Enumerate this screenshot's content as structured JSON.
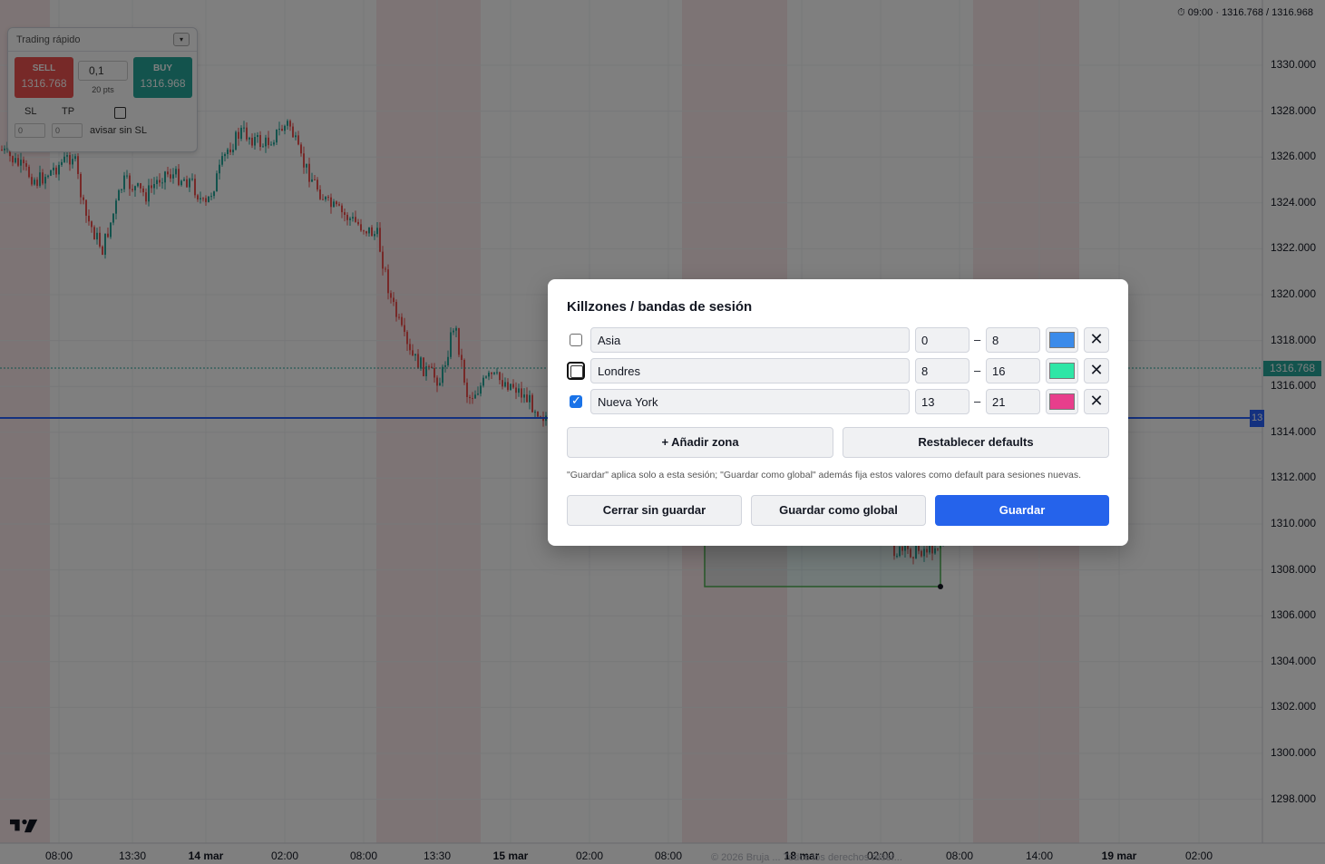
{
  "top_info": "⏱ 09:00 · 1316.768 / 1316.968",
  "price_axis": {
    "labels": [
      "1330.000",
      "1328.000",
      "1326.000",
      "1324.000",
      "1322.000",
      "1320.000",
      "1318.000",
      "1316.000",
      "1314.000",
      "1312.000",
      "1310.000",
      "1308.000",
      "1306.000",
      "1304.000",
      "1302.000",
      "1300.000",
      "1298.000"
    ],
    "current_price": "1316.768",
    "hline_tag": "13"
  },
  "time_axis": {
    "labels": [
      {
        "text": "08:00",
        "bold": false
      },
      {
        "text": "13:30",
        "bold": false
      },
      {
        "text": "14 mar",
        "bold": true
      },
      {
        "text": "02:00",
        "bold": false
      },
      {
        "text": "08:00",
        "bold": false
      },
      {
        "text": "13:30",
        "bold": false
      },
      {
        "text": "15 mar",
        "bold": true
      },
      {
        "text": "02:00",
        "bold": false
      },
      {
        "text": "08:00",
        "bold": false
      },
      {
        "text": "18 mar",
        "bold": true
      },
      {
        "text": "02:00",
        "bold": false
      },
      {
        "text": "08:00",
        "bold": false
      },
      {
        "text": "14:00",
        "bold": false
      },
      {
        "text": "19 mar",
        "bold": true
      },
      {
        "text": "02:00",
        "bold": false
      }
    ]
  },
  "copyright": "© 2026 Bruja ... Todos los derechos reser...",
  "quick_trading": {
    "title": "Trading rápido",
    "toggle_icon": "▾",
    "sell_label": "SELL",
    "sell_price": "1316.768",
    "buy_label": "BUY",
    "buy_price": "1316.968",
    "quantity": "0,1",
    "points": "20 pts",
    "sl_label": "SL",
    "tp_label": "TP",
    "sl_value": "0",
    "tp_value": "0",
    "warn_label": "avisar sin SL",
    "warn_checked": false
  },
  "modal": {
    "title": "Killzones / bandas de sesión",
    "zones": [
      {
        "name": "Asia",
        "start": "0",
        "end": "8",
        "color": "#3b8bea",
        "checked": false,
        "focused": false
      },
      {
        "name": "Londres",
        "start": "8",
        "end": "16",
        "color": "#2ee6a6",
        "checked": false,
        "focused": true
      },
      {
        "name": "Nueva York",
        "start": "13",
        "end": "21",
        "color": "#e83e8c",
        "checked": true,
        "focused": false
      }
    ],
    "dash": "–",
    "remove_icon": "✕",
    "add_zone_label": "+ Añadir zona",
    "reset_label": "Restablecer defaults",
    "note": "\"Guardar\" aplica solo a esta sesión; \"Guardar como global\" además fija estos valores como default para sesiones nuevas.",
    "close_label": "Cerrar sin guardar",
    "save_global_label": "Guardar como global",
    "save_label": "Guardar"
  },
  "colors": {
    "up": "#26a69a",
    "down": "#ef5350",
    "hline": "#2962ff",
    "primary_button": "#2563eb"
  }
}
